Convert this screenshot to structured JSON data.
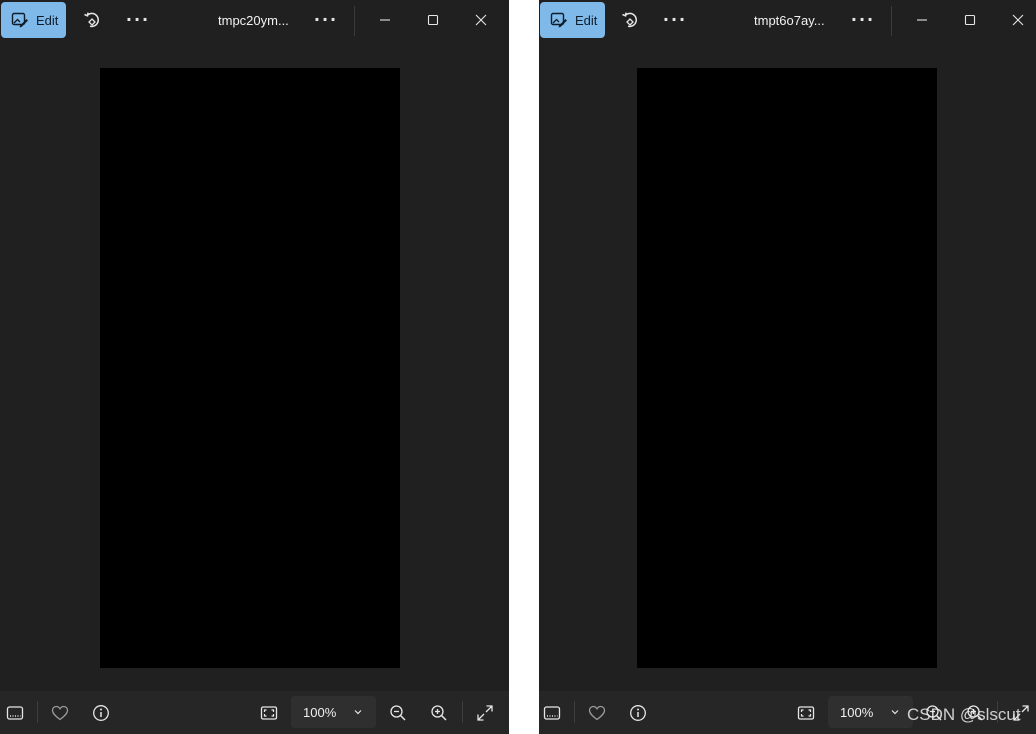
{
  "windows": [
    {
      "title": "tmpc20ym...",
      "edit_label": "Edit",
      "zoom_value": "100%"
    },
    {
      "title": "tmpt6o7ay...",
      "edit_label": "Edit",
      "zoom_value": "100%"
    }
  ],
  "toolbar": {
    "more_glyph": "···"
  },
  "watermark": "CSDN @slscut",
  "colors": {
    "background": "#202020",
    "accent": "#7fb9ea",
    "image": "#000000"
  }
}
